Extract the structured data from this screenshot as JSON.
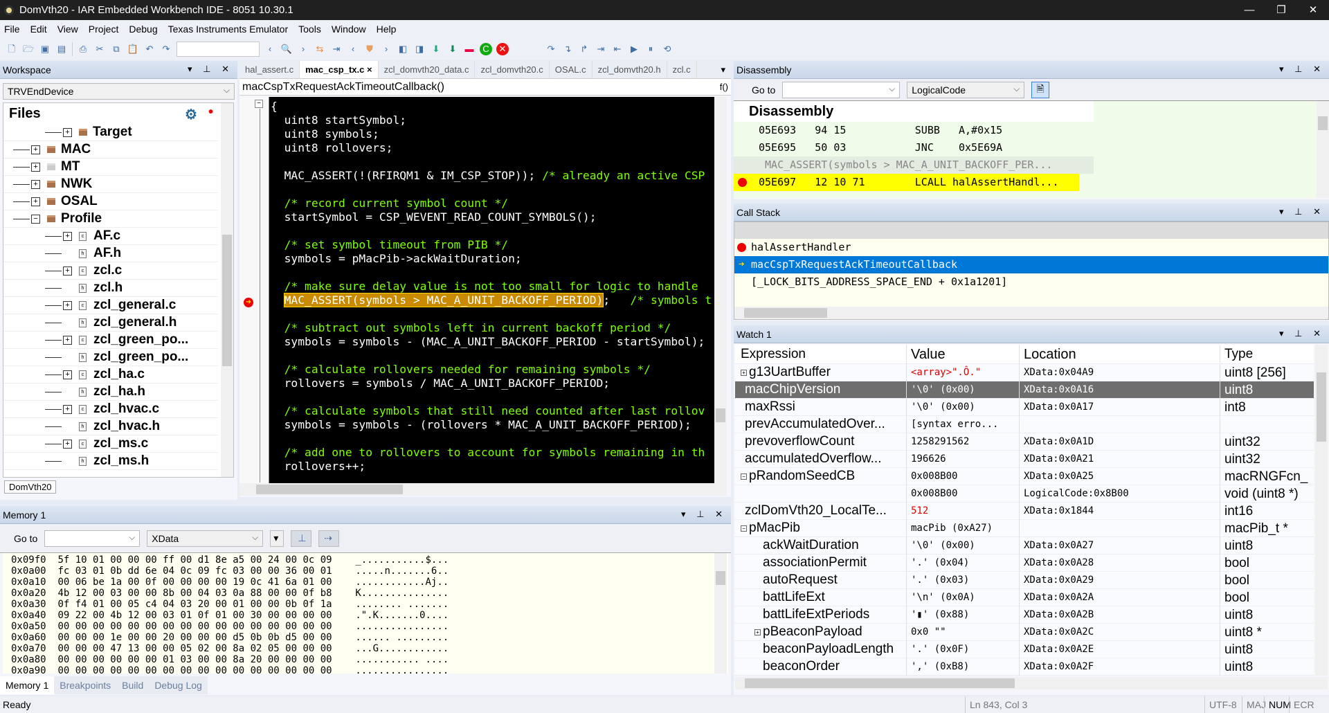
{
  "window": {
    "title": "DomVth20 - IAR Embedded Workbench IDE - 8051 10.30.1"
  },
  "menu": [
    "File",
    "Edit",
    "View",
    "Project",
    "Debug",
    "Texas Instruments Emulator",
    "Tools",
    "Window",
    "Help"
  ],
  "workspace": {
    "title": "Workspace",
    "config": "TRVEndDevice",
    "files_header": "Files",
    "bottom_tab": "DomVth20",
    "tree": [
      {
        "label": "Target",
        "level": 2,
        "exp": "+",
        "icon": "folder"
      },
      {
        "label": "MAC",
        "level": 1,
        "exp": "+",
        "icon": "folder"
      },
      {
        "label": "MT",
        "level": 1,
        "exp": "+",
        "icon": "folder-gray"
      },
      {
        "label": "NWK",
        "level": 1,
        "exp": "+",
        "icon": "folder"
      },
      {
        "label": "OSAL",
        "level": 1,
        "exp": "+",
        "icon": "folder"
      },
      {
        "label": "Profile",
        "level": 1,
        "exp": "-",
        "icon": "folder"
      },
      {
        "label": "AF.c",
        "level": 2,
        "exp": "+",
        "icon": "c"
      },
      {
        "label": "AF.h",
        "level": 2,
        "exp": "",
        "icon": "h"
      },
      {
        "label": "zcl.c",
        "level": 2,
        "exp": "+",
        "icon": "c"
      },
      {
        "label": "zcl.h",
        "level": 2,
        "exp": "",
        "icon": "h"
      },
      {
        "label": "zcl_general.c",
        "level": 2,
        "exp": "+",
        "icon": "c"
      },
      {
        "label": "zcl_general.h",
        "level": 2,
        "exp": "",
        "icon": "h"
      },
      {
        "label": "zcl_green_po...",
        "level": 2,
        "exp": "+",
        "icon": "c"
      },
      {
        "label": "zcl_green_po...",
        "level": 2,
        "exp": "",
        "icon": "h"
      },
      {
        "label": "zcl_ha.c",
        "level": 2,
        "exp": "+",
        "icon": "c"
      },
      {
        "label": "zcl_ha.h",
        "level": 2,
        "exp": "",
        "icon": "h"
      },
      {
        "label": "zcl_hvac.c",
        "level": 2,
        "exp": "+",
        "icon": "c"
      },
      {
        "label": "zcl_hvac.h",
        "level": 2,
        "exp": "",
        "icon": "h"
      },
      {
        "label": "zcl_ms.c",
        "level": 2,
        "exp": "+",
        "icon": "c"
      },
      {
        "label": "zcl_ms.h",
        "level": 2,
        "exp": "",
        "icon": "h"
      }
    ]
  },
  "editor": {
    "tabs": [
      {
        "label": "hal_assert.c",
        "active": false
      },
      {
        "label": "mac_csp_tx.c",
        "active": true
      },
      {
        "label": "zcl_domvth20_data.c",
        "active": false
      },
      {
        "label": "zcl_domvth20.c",
        "active": false
      },
      {
        "label": "OSAL.c",
        "active": false
      },
      {
        "label": "zcl_domvth20.h",
        "active": false
      },
      {
        "label": "zcl.c",
        "active": false
      }
    ],
    "close_glyph": "×",
    "function": "macCspTxRequestAckTimeoutCallback()",
    "func_icon": "f()",
    "lines": [
      {
        "code": "{"
      },
      {
        "code": "  uint8 startSymbol;"
      },
      {
        "code": "  uint8 symbols;"
      },
      {
        "code": "  uint8 rollovers;"
      },
      {
        "code": ""
      },
      {
        "code": "  MAC_ASSERT(!(RFIRQM1 & IM_CSP_STOP)); ",
        "comment": "/* already an active CSP"
      },
      {
        "code": ""
      },
      {
        "code": "  ",
        "comment": "/* record current symbol count */"
      },
      {
        "code": "  startSymbol = CSP_WEVENT_READ_COUNT_SYMBOLS();"
      },
      {
        "code": ""
      },
      {
        "code": "  ",
        "comment": "/* set symbol timeout from PIB */"
      },
      {
        "code": "  symbols = pMacPib->ackWaitDuration;"
      },
      {
        "code": ""
      },
      {
        "code": "  ",
        "comment": "/* make sure delay value is not too small for logic to handle"
      },
      {
        "code": "  ",
        "hl": "MAC_ASSERT(symbols > MAC_A_UNIT_BACKOFF_PERIOD)",
        "post": ";   ",
        "comment": "/* symbols t",
        "current": true
      },
      {
        "code": ""
      },
      {
        "code": "  ",
        "comment": "/* subtract out symbols left in current backoff period */"
      },
      {
        "code": "  symbols = symbols - (MAC_A_UNIT_BACKOFF_PERIOD - startSymbol);"
      },
      {
        "code": ""
      },
      {
        "code": "  ",
        "comment": "/* calculate rollovers needed for remaining symbols */"
      },
      {
        "code": "  rollovers = symbols / MAC_A_UNIT_BACKOFF_PERIOD;"
      },
      {
        "code": ""
      },
      {
        "code": "  ",
        "comment": "/* calculate symbols that still need counted after last rollov"
      },
      {
        "code": "  symbols = symbols - (rollovers * MAC_A_UNIT_BACKOFF_PERIOD);"
      },
      {
        "code": ""
      },
      {
        "code": "  ",
        "comment": "/* add one to rollovers to account for symbols remaining in th"
      },
      {
        "code": "  rollovers++;"
      }
    ]
  },
  "memory": {
    "title": "Memory 1",
    "goto_label": "Go to",
    "goto_value": "",
    "zone": "XData",
    "rows": [
      {
        "addr": "0x09f0",
        "bytes": "5f 10 01 00 00 00 ff 00 d1 8e a5 00 24 00 0c 09",
        "ascii": "_...........$..."
      },
      {
        "addr": "0x0a00",
        "bytes": "fc 03 01 0b dd 6e 04 0c 09 fc 03 00 00 36 00 01",
        "ascii": ".....n.......6.."
      },
      {
        "addr": "0x0a10",
        "bytes": "00 06 be 1a 00 0f 00 00 00 00 19 0c 41 6a 01 00",
        "ascii": "............Aj.."
      },
      {
        "addr": "0x0a20",
        "bytes": "4b 12 00 03 00 00 8b 00 04 03 0a 88 00 00 0f b8",
        "ascii": "K..............."
      },
      {
        "addr": "0x0a30",
        "bytes": "0f f4 01 00 05 c4 04 03 20 00 01 00 00 0b 0f 1a",
        "ascii": "........ ......."
      },
      {
        "addr": "0x0a40",
        "bytes": "09 22 00 4b 12 00 03 01 0f 01 00 30 00 00 00 00",
        "ascii": ".\".K.......0...."
      },
      {
        "addr": "0x0a50",
        "bytes": "00 00 00 00 00 00 00 00 00 00 00 00 00 00 00 00",
        "ascii": "................"
      },
      {
        "addr": "0x0a60",
        "bytes": "00 00 00 1e 00 00 20 00 00 00 d5 0b 0b d5 00 00",
        "ascii": "...... ........."
      },
      {
        "addr": "0x0a70",
        "bytes": "00 00 00 47 13 00 00 05 02 00 8a 02 05 00 00 00",
        "ascii": "...G............"
      },
      {
        "addr": "0x0a80",
        "bytes": "00 00 00 00 00 00 01 03 00 00 8a 20 00 00 00 00",
        "ascii": "........... ...."
      },
      {
        "addr": "0x0a90",
        "bytes": "00 00 00 00 00 00 00 00 00 00 00 00 00 00 00 00",
        "ascii": "................"
      }
    ],
    "tabs": [
      {
        "label": "Memory 1",
        "active": true
      },
      {
        "label": "Breakpoints",
        "active": false
      },
      {
        "label": "Build",
        "active": false
      },
      {
        "label": "Debug Log",
        "active": false
      }
    ]
  },
  "disassembly": {
    "title": "Disassembly",
    "goto_label": "Go to",
    "goto_value": "",
    "zone": "LogicalCode",
    "header": "Disassembly",
    "rows": [
      {
        "text": "05E693   94 15           SUBB   A,#0x15",
        "kind": "normal"
      },
      {
        "text": "05E695   50 03           JNC    0x5E69A",
        "kind": "normal"
      },
      {
        "text": " MAC_ASSERT(symbols > MAC_A_UNIT_BACKOFF_PER...",
        "kind": "source"
      },
      {
        "text": "05E697   12 10 71        LCALL halAssertHandl...",
        "kind": "current",
        "breakpoint": true
      }
    ]
  },
  "callstack": {
    "title": "Call Stack",
    "rows": [
      {
        "text": "halAssertHandler",
        "marker": "breakpoint"
      },
      {
        "text": "macCspTxRequestAckTimeoutCallback",
        "marker": "arrow",
        "selected": true
      },
      {
        "text": "[_LOCK_BITS_ADDRESS_SPACE_END + 0x1a1201]",
        "marker": ""
      }
    ]
  },
  "watch": {
    "title": "Watch 1",
    "columns": [
      "Expression",
      "Value",
      "Location",
      "Type"
    ],
    "rows": [
      {
        "expr": "g13UartBuffer",
        "value": "<array>\".Ô.\"",
        "loc": "XData:0x04A9",
        "type": "uint8 [256]",
        "exp": "+",
        "indent": 0,
        "red": true
      },
      {
        "expr": "macChipVersion",
        "value": "'\\0'  (0x00)",
        "loc": "XData:0x0A16",
        "type": "uint8",
        "exp": "",
        "indent": 0,
        "selected": true
      },
      {
        "expr": "maxRssi",
        "value": "'\\0'  (0x00)",
        "loc": "XData:0x0A17",
        "type": "int8",
        "exp": "",
        "indent": 0
      },
      {
        "expr": "prevAccumulatedOver...",
        "value": "[syntax erro...",
        "loc": "",
        "type": "",
        "exp": "",
        "indent": 0
      },
      {
        "expr": "prevoverflowCount",
        "value": "1258291562",
        "loc": "XData:0x0A1D",
        "type": "uint32",
        "exp": "",
        "indent": 0
      },
      {
        "expr": "accumulatedOverflow...",
        "value": "196626",
        "loc": "XData:0x0A21",
        "type": "uint32",
        "exp": "",
        "indent": 0
      },
      {
        "expr": "pRandomSeedCB",
        "value": "0x008B00",
        "loc": "XData:0x0A25",
        "type": "macRNGFcn_",
        "exp": "-",
        "indent": 0
      },
      {
        "expr": "",
        "value": "0x008B00",
        "loc": "LogicalCode:0x8B00",
        "type": "void (uint8 *)",
        "exp": "",
        "indent": 1
      },
      {
        "expr": "zclDomVth20_LocalTe...",
        "value": "512",
        "loc": "XData:0x1844",
        "type": "int16",
        "exp": "",
        "indent": 0,
        "red": true
      },
      {
        "expr": "pMacPib",
        "value": "macPib (0xA27)",
        "loc": "",
        "type": "macPib_t *",
        "exp": "-",
        "indent": 0
      },
      {
        "expr": "ackWaitDuration",
        "value": "'\\0'  (0x00)",
        "loc": "XData:0x0A27",
        "type": "uint8",
        "exp": "",
        "indent": 1
      },
      {
        "expr": "associationPermit",
        "value": "'.'  (0x04)",
        "loc": "XData:0x0A28",
        "type": "bool",
        "exp": "",
        "indent": 1
      },
      {
        "expr": "autoRequest",
        "value": "'.'  (0x03)",
        "loc": "XData:0x0A29",
        "type": "bool",
        "exp": "",
        "indent": 1
      },
      {
        "expr": "battLifeExt",
        "value": "'\\n'  (0x0A)",
        "loc": "XData:0x0A2A",
        "type": "bool",
        "exp": "",
        "indent": 1
      },
      {
        "expr": "battLifeExtPeriods",
        "value": "'▮'  (0x88)",
        "loc": "XData:0x0A2B",
        "type": "uint8",
        "exp": "",
        "indent": 1
      },
      {
        "expr": "pBeaconPayload",
        "value": "0x0  \"\"",
        "loc": "XData:0x0A2C",
        "type": "uint8 *",
        "exp": "+",
        "indent": 1
      },
      {
        "expr": "beaconPayloadLength",
        "value": "'.'  (0x0F)",
        "loc": "XData:0x0A2E",
        "type": "uint8",
        "exp": "",
        "indent": 1
      },
      {
        "expr": "beaconOrder",
        "value": "','  (0xB8)",
        "loc": "XData:0x0A2F",
        "type": "uint8",
        "exp": "",
        "indent": 1
      }
    ]
  },
  "status": {
    "left": "Ready",
    "position": "Ln 843, Col 3",
    "encoding": "UTF-8",
    "caps": "MAJ",
    "num": "NUM",
    "ovr": "ECR"
  },
  "colors": {
    "accent": "#0078d7",
    "comment": "#7fff00",
    "highlight": "#c98a00",
    "current_line": "#ffff00",
    "breakpoint": "#e00000"
  }
}
